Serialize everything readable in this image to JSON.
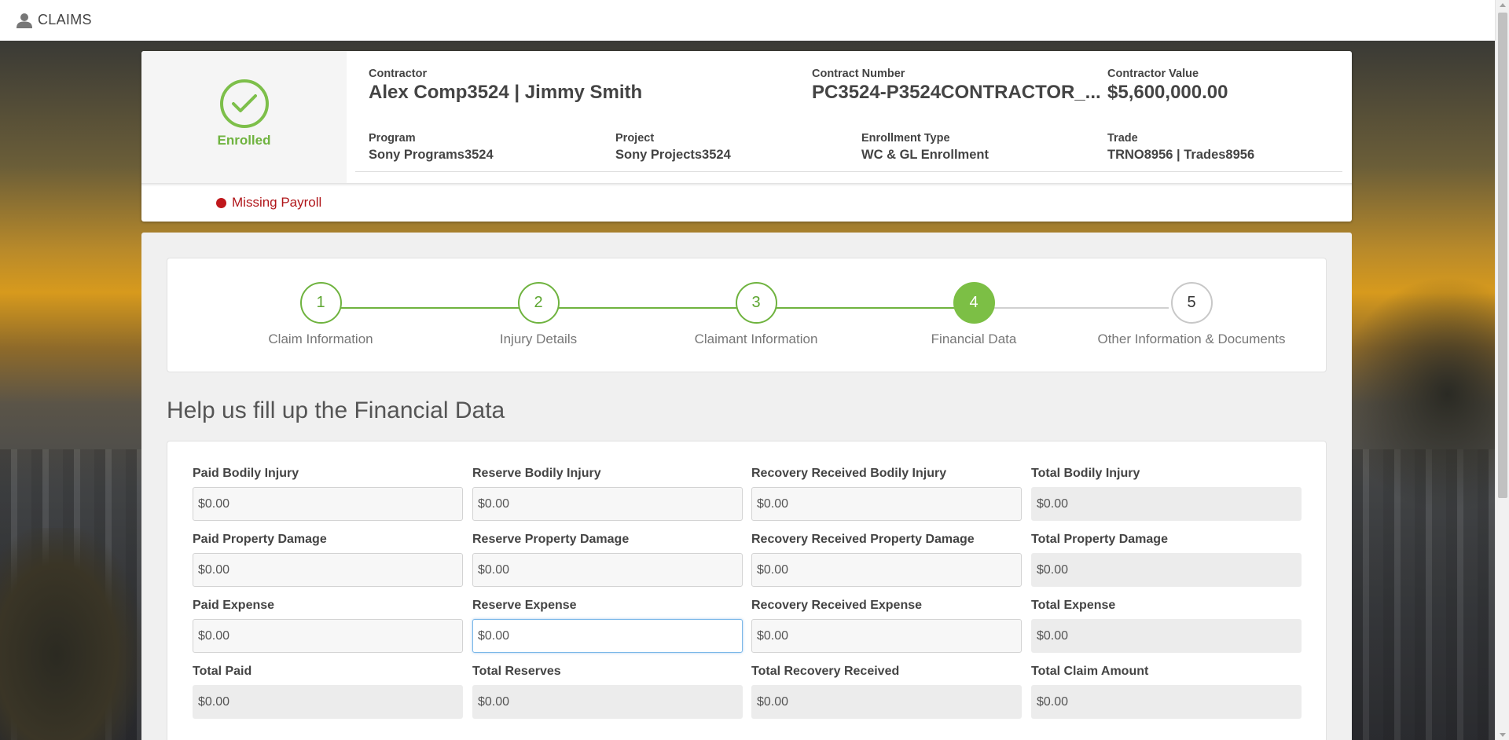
{
  "header": {
    "title": "CLAIMS",
    "icon": "user-icon"
  },
  "enrollment": {
    "status": "Enrolled",
    "status_color": "#6fb33f",
    "contractor_label": "Contractor",
    "contractor_value": "Alex Comp3524 | Jimmy Smith",
    "contract_number_label": "Contract Number",
    "contract_number_value": "PC3524-P3524CONTRACTOR_...",
    "contractor_value_label": "Contractor Value",
    "contractor_value_value": "$5,600,000.00",
    "program_label": "Program",
    "program_value": "Sony Programs3524",
    "project_label": "Project",
    "project_value": "Sony Projects3524",
    "enrollment_type_label": "Enrollment Type",
    "enrollment_type_value": "WC & GL Enrollment",
    "trade_label": "Trade",
    "trade_value": "TRNO8956 | Trades8956",
    "alert": "Missing Payroll",
    "alert_color": "#c0181c"
  },
  "stepper": {
    "current_step": 4,
    "steps": [
      {
        "number": "1",
        "label": "Claim Information"
      },
      {
        "number": "2",
        "label": "Injury Details"
      },
      {
        "number": "3",
        "label": "Claimant Information"
      },
      {
        "number": "4",
        "label": "Financial Data"
      },
      {
        "number": "5",
        "label": "Other Information & Documents"
      }
    ]
  },
  "financial": {
    "title": "Help us fill up the Financial Data",
    "rows": [
      [
        {
          "label": "Paid Bodily Injury",
          "value": "$0.00"
        },
        {
          "label": "Reserve Bodily Injury",
          "value": "$0.00"
        },
        {
          "label": "Recovery Received Bodily Injury",
          "value": "$0.00"
        },
        {
          "label": "Total Bodily Injury",
          "value": "$0.00"
        }
      ],
      [
        {
          "label": "Paid Property Damage",
          "value": "$0.00"
        },
        {
          "label": "Reserve Property Damage",
          "value": "$0.00"
        },
        {
          "label": "Recovery Received Property Damage",
          "value": "$0.00"
        },
        {
          "label": "Total Property Damage",
          "value": "$0.00"
        }
      ],
      [
        {
          "label": "Paid Expense",
          "value": "$0.00"
        },
        {
          "label": "Reserve Expense",
          "value": "$0.00"
        },
        {
          "label": "Recovery Received Expense",
          "value": "$0.00"
        },
        {
          "label": "Total Expense",
          "value": "$0.00"
        }
      ],
      [
        {
          "label": "Total Paid",
          "value": "$0.00"
        },
        {
          "label": "Total Reserves",
          "value": "$0.00"
        },
        {
          "label": "Total Recovery Received",
          "value": "$0.00"
        },
        {
          "label": "Total Claim Amount",
          "value": "$0.00"
        }
      ]
    ]
  }
}
